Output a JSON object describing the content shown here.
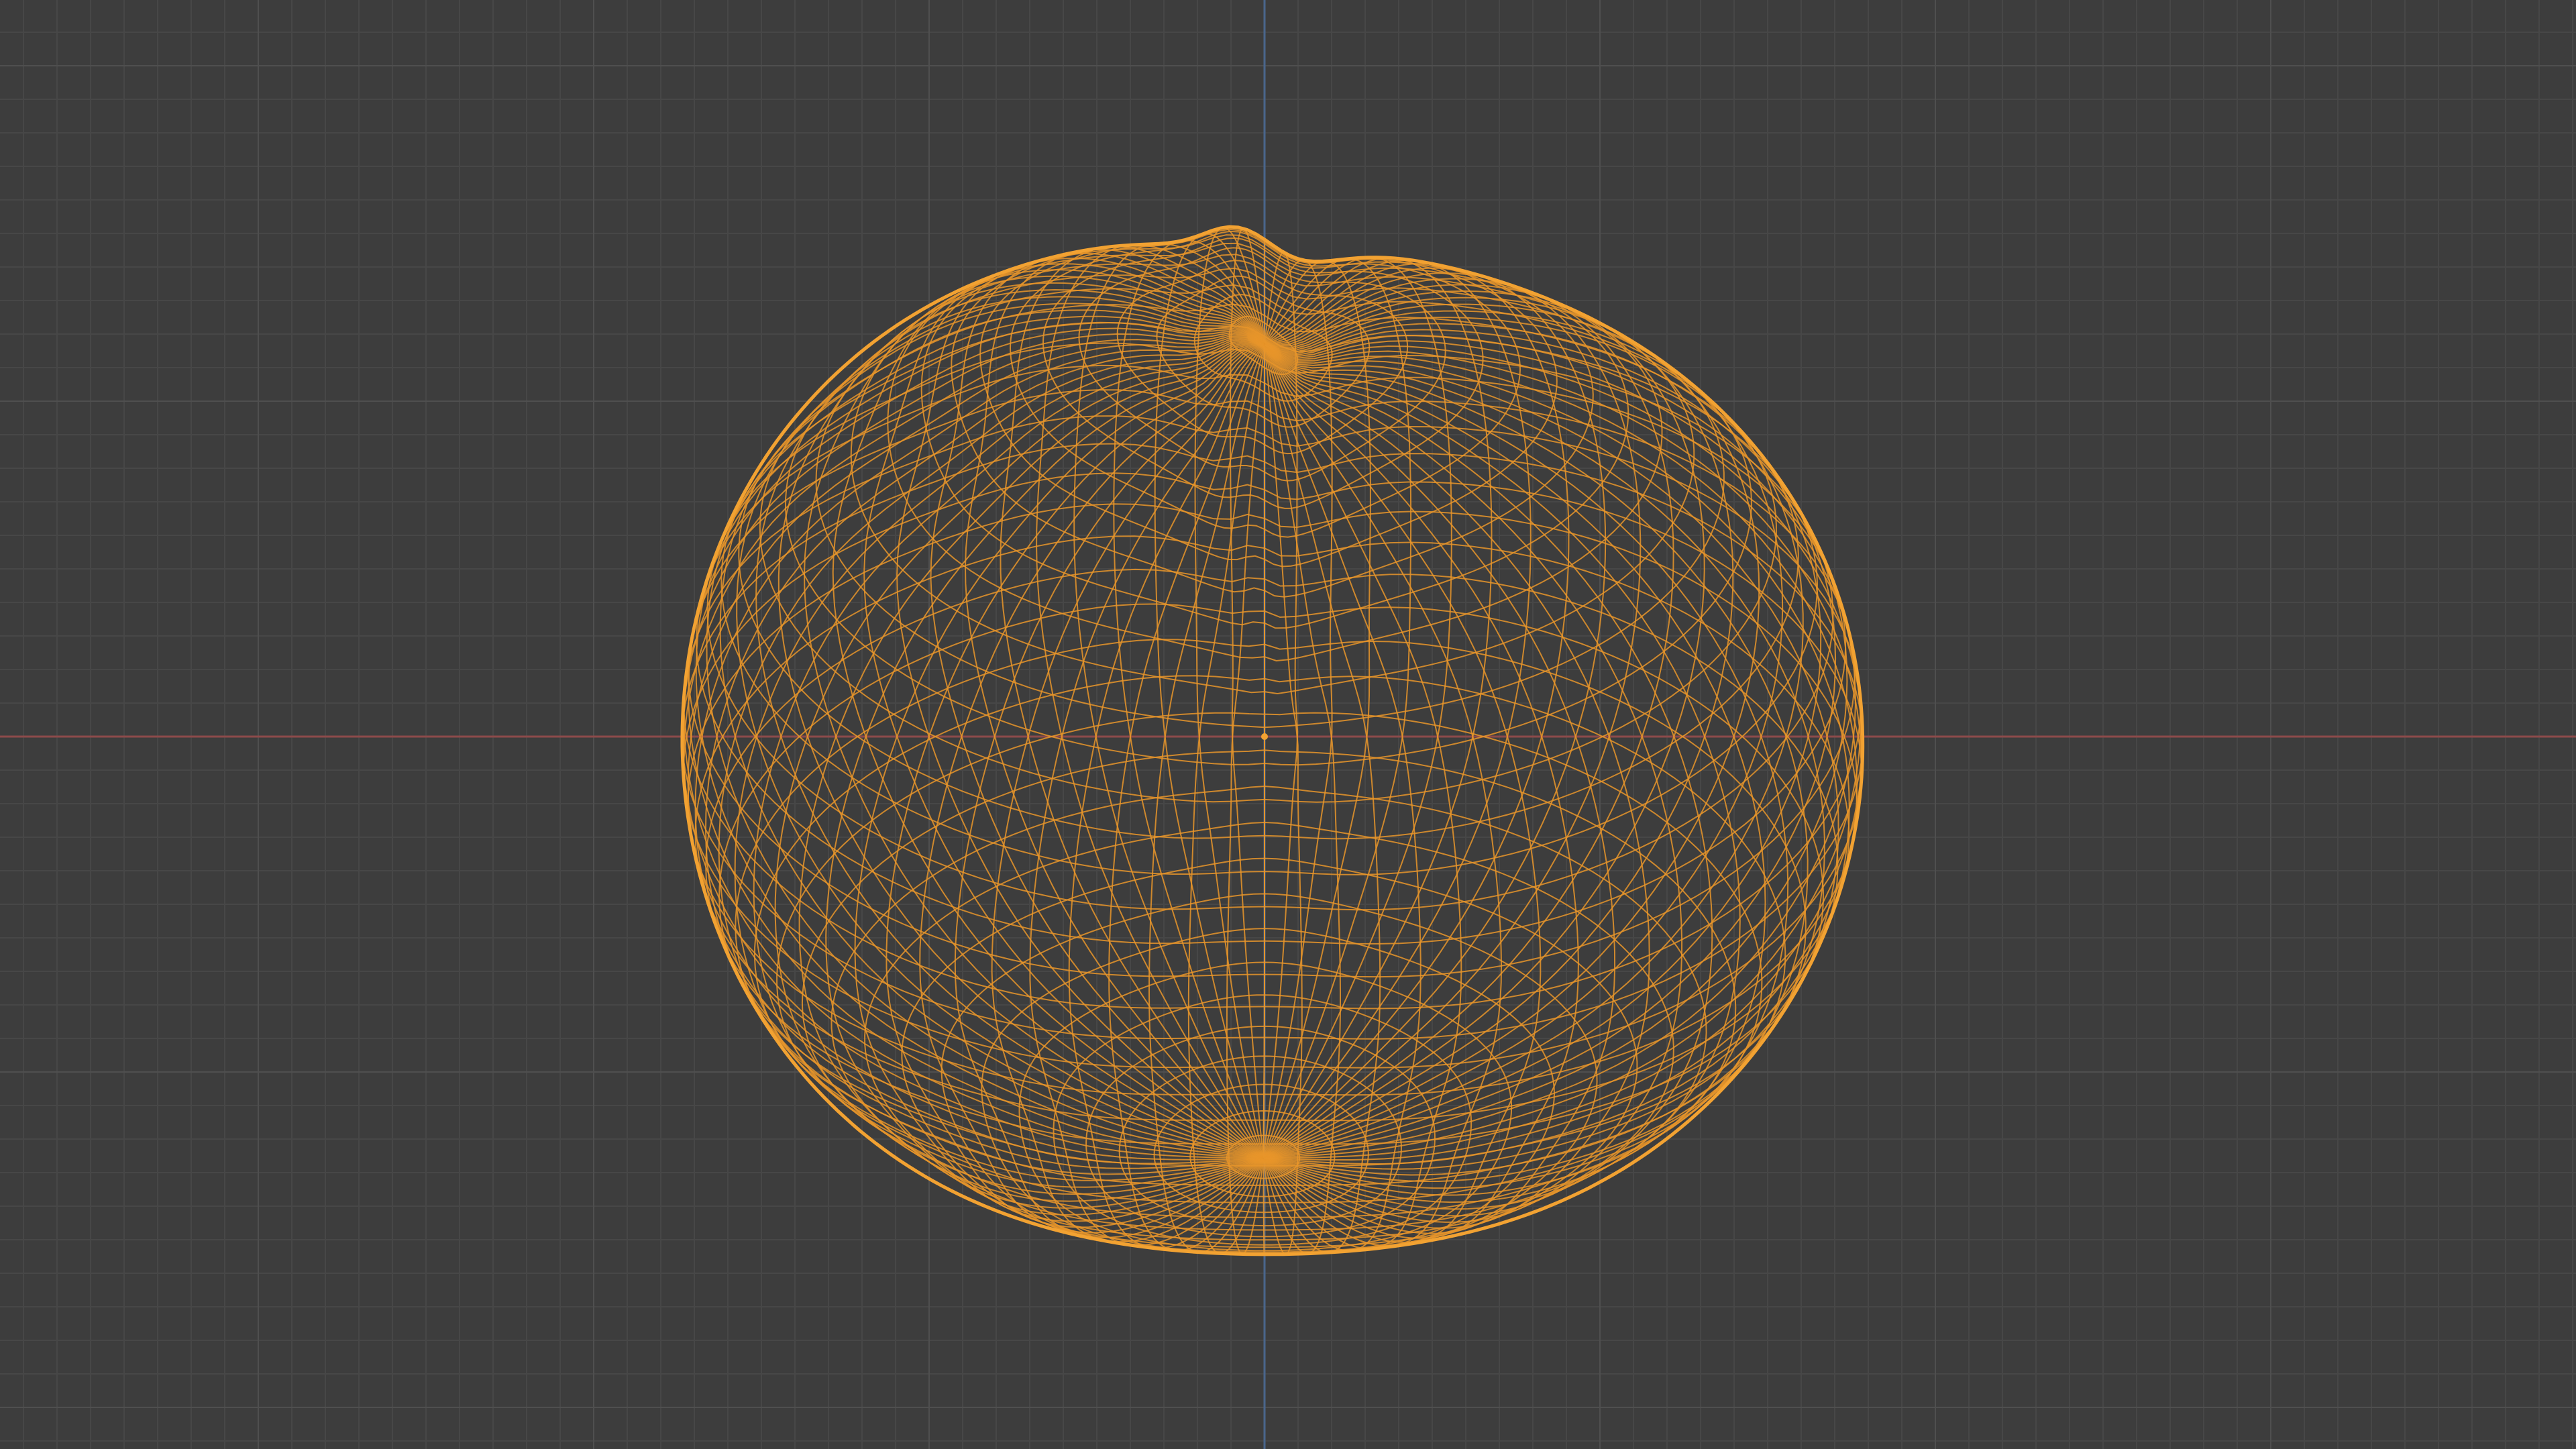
{
  "viewport": {
    "mode": "wireframe",
    "view": "top-orthographic",
    "background_color": "#3d3d3d",
    "grid_color": "#474747",
    "grid_major_color": "#4f4f4f",
    "x_axis_color": "#8c4a4a",
    "y_axis_color": "#4a668c",
    "wire_color": "#e8952a",
    "outline_color": "#f2a232"
  },
  "object": {
    "type": "deformed-sphere-mesh",
    "selected": true,
    "icon": "mesh-wireframe-icon"
  }
}
